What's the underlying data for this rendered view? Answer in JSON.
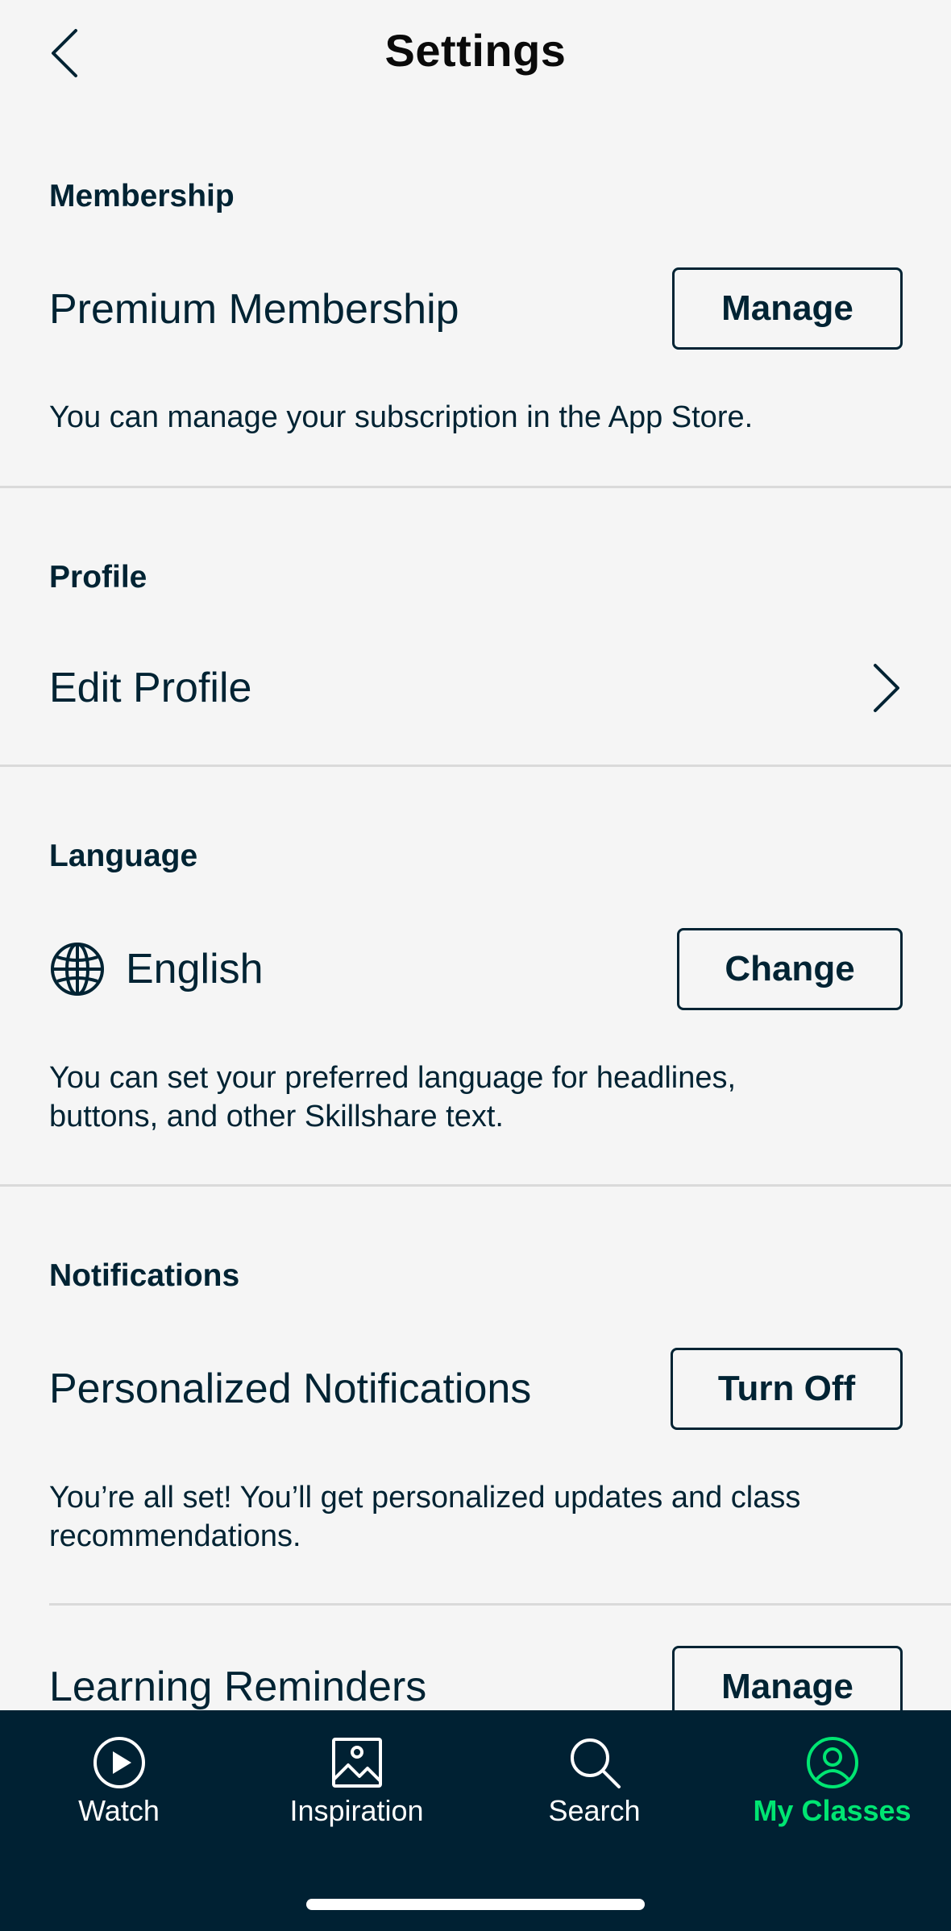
{
  "header": {
    "title": "Settings",
    "back_icon": "chevron-left-icon"
  },
  "membership": {
    "section_title": "Membership",
    "row_label": "Premium Membership",
    "button_label": "Manage",
    "description": "You can manage your subscription in the App Store."
  },
  "profile": {
    "section_title": "Profile",
    "row_label": "Edit Profile",
    "chevron_icon": "chevron-right-icon"
  },
  "language": {
    "section_title": "Language",
    "row_label": "English",
    "icon": "globe-icon",
    "button_label": "Change",
    "description_line1": "You can set your preferred language for headlines,",
    "description_line2": "buttons, and other Skillshare text."
  },
  "notifications": {
    "section_title": "Notifications",
    "personalized_label": "Personalized Notifications",
    "personalized_button": "Turn Off",
    "personalized_desc_line1": "You’re all set! You’ll get personalized updates and class",
    "personalized_desc_line2": "recommendations.",
    "reminders_label": "Learning Reminders",
    "reminders_button": "Manage"
  },
  "tabbar": {
    "tabs": [
      {
        "label": "Watch",
        "icon": "play-circle-icon",
        "active": false
      },
      {
        "label": "Inspiration",
        "icon": "image-icon",
        "active": false
      },
      {
        "label": "Search",
        "icon": "search-icon",
        "active": false
      },
      {
        "label": "My Classes",
        "icon": "user-circle-icon",
        "active": true
      }
    ]
  },
  "colors": {
    "background": "#f5f5f5",
    "text": "#002333",
    "tabbar_bg": "#002133",
    "active_tab": "#00e572",
    "divider": "#dadada"
  }
}
